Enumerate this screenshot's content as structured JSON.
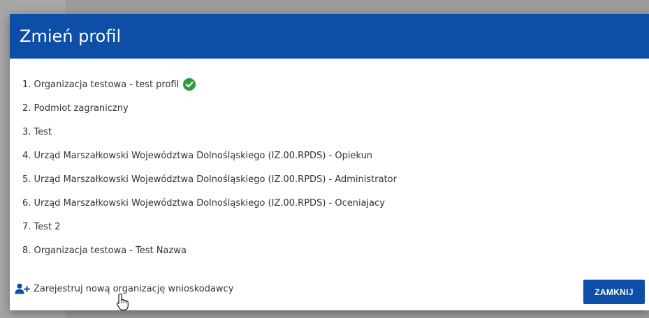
{
  "dialog": {
    "title": "Zmień profil",
    "profiles": [
      {
        "label": "1. Organizacja testowa - test profil",
        "active": true
      },
      {
        "label": "2. Podmiot zagraniczny",
        "active": false
      },
      {
        "label": "3. Test",
        "active": false
      },
      {
        "label": "4. Urząd Marszałkowski Województwa Dolnośląskiego (IZ.00.RPDS) - Opiekun",
        "active": false
      },
      {
        "label": "5. Urząd Marszałkowski Województwa Dolnośląskiego (IZ.00.RPDS) - Administrator",
        "active": false
      },
      {
        "label": "6. Urząd Marszałkowski Województwa Dolnośląskiego (IZ.00.RPDS) - Oceniajacy",
        "active": false
      },
      {
        "label": "7. Test 2",
        "active": false
      },
      {
        "label": "8. Organizacja testowa - Test Nazwa",
        "active": false
      }
    ],
    "active_icon": "check-circle-icon",
    "register_icon": "user-plus-icon",
    "register_label": "Zarejestruj nową organizację wnioskodawcy",
    "close_label": "ZAMKNIJ"
  },
  "colors": {
    "header": "#0d4ea6",
    "button": "#0d4ea6",
    "check": "#2e9d3a"
  }
}
